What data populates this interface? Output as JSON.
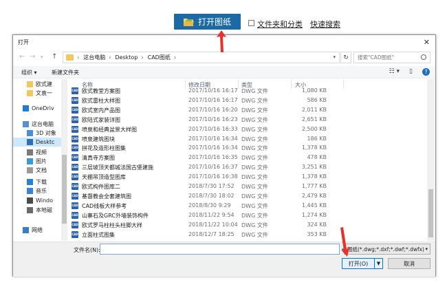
{
  "toolbar": {
    "open_drawing_label": "打开图纸",
    "folder_classify_label": "文件夹和分类",
    "quick_search_label": "快速搜索"
  },
  "dialog": {
    "title": "打开",
    "close_glyph": "✕",
    "nav": {
      "back": "←",
      "forward": "→",
      "up": "↑",
      "refresh": "↻"
    },
    "breadcrumb": [
      "这台电脑",
      "Desktop",
      "CAD图纸"
    ],
    "search_placeholder": "搜索\"CAD图纸\"",
    "commands": {
      "organize": "组织 ▾",
      "new_folder": "新建文件夹"
    },
    "sidebar": [
      {
        "label": "欧式建"
      },
      {
        "label": "文袁一"
      },
      {
        "label": "OneDriv"
      },
      {
        "label": "这台电脑"
      },
      {
        "label": "3D 对象"
      },
      {
        "label": "Desktc"
      },
      {
        "label": "视频"
      },
      {
        "label": "图片"
      },
      {
        "label": "文档"
      },
      {
        "label": "下载"
      },
      {
        "label": "音乐"
      },
      {
        "label": "Windo"
      },
      {
        "label": "本地磁"
      },
      {
        "label": "网络"
      }
    ],
    "columns": {
      "name": "名称",
      "date": "修改日期",
      "type": "类型",
      "size": "大小"
    },
    "files": [
      {
        "name": "欧式教堂方案图",
        "date": "2017/10/16 16:17",
        "type": "DWG 文件",
        "size": "1,080 KB"
      },
      {
        "name": "欧式雷柱大样图",
        "date": "2017/10/16 16:17",
        "type": "DWG 文件",
        "size": "586 KB"
      },
      {
        "name": "欧式室内产品图",
        "date": "2017/10/16 16:20",
        "type": "DWG 文件",
        "size": "2,011 KB"
      },
      {
        "name": "欧陆式家装详图",
        "date": "2017/10/16 16:23",
        "type": "DWG 文件",
        "size": "2,651 KB"
      },
      {
        "name": "喷泉和经典盆景大样图",
        "date": "2017/10/16 16:33",
        "type": "DWG 文件",
        "size": "2,500 KB"
      },
      {
        "name": "喷泉建筑图块",
        "date": "2017/10/16 16:34",
        "type": "DWG 文件",
        "size": "186 KB"
      },
      {
        "name": "拼花及造形柱图集",
        "date": "2017/10/16 16:34",
        "type": "DWG 文件",
        "size": "1,378 KB"
      },
      {
        "name": "清真寺方案图",
        "date": "2017/10/16 16:35",
        "type": "DWG 文件",
        "size": "478 KB"
      },
      {
        "name": "三层坡顶天都城法国古堡建施",
        "date": "2017/10/16 16:37",
        "type": "DWG 文件",
        "size": "3,251 KB"
      },
      {
        "name": "天棚吊顶造型图库",
        "date": "2017/10/16 16:38",
        "type": "DWG 文件",
        "size": "1,378 KB"
      },
      {
        "name": "欧式构件图库二",
        "date": "2018/7/30 17:52",
        "type": "DWG 文件",
        "size": "1,777 KB"
      },
      {
        "name": "基督教会全套建筑图",
        "date": "2018/7/30 18:02",
        "type": "DWG 文件",
        "size": "2,479 KB"
      },
      {
        "name": "CAD线板大样参考",
        "date": "2018/8/30 9:29",
        "type": "DWG 文件",
        "size": "1,445 KB"
      },
      {
        "name": "山寨石及GRC外墙装饰构件",
        "date": "2018/11/22 9:54",
        "type": "DWG 文件",
        "size": "1,274 KB"
      },
      {
        "name": "欧式罗马柱柱头柱脚大样",
        "date": "2018/11/22 10:04",
        "type": "DWG 文件",
        "size": "324 KB"
      },
      {
        "name": "立面柱式图集",
        "date": "2018/12/7 18:25",
        "type": "DWG 文件",
        "size": "353 KB"
      }
    ],
    "filename_label": "文件名(N):",
    "filename_value": "",
    "filter_label": "图纸(*.dwg;*.dxf;*.dwf;*.dwfx)",
    "open_button": "打开(O)",
    "cancel_button": "取消"
  },
  "colors": {
    "toolbar_button": "#1c6aa5",
    "annotation_arrow": "#e8312a",
    "accent": "#0078d7"
  }
}
